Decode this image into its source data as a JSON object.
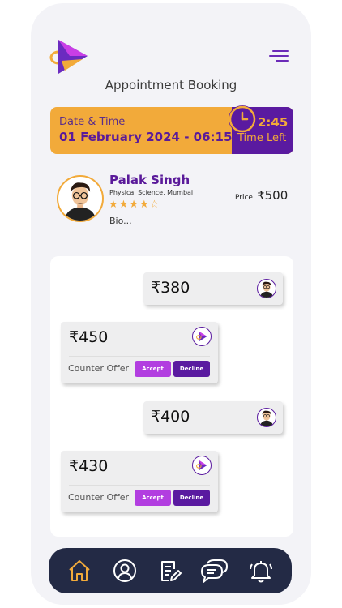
{
  "header": {
    "title": "Appointment Booking"
  },
  "datetime": {
    "label": "Date & Time",
    "value": "01 February 2024 - 06:15",
    "countdown": "2:45",
    "time_left_label": "Time Left"
  },
  "profile": {
    "name": "Palak Singh",
    "subtitle": "Physical Science, Mumbai",
    "rating": 4,
    "rating_max": 5,
    "stars_text": "★★★★☆",
    "bio": "Bio...",
    "price_label": "Price",
    "price_value": "₹500"
  },
  "offers": [
    {
      "side": "user",
      "amount": "₹380"
    },
    {
      "side": "tutor",
      "amount": "₹450",
      "counter_label": "Counter Offer",
      "accept_label": "Accept",
      "decline_label": "Decline"
    },
    {
      "side": "user",
      "amount": "₹400"
    },
    {
      "side": "tutor",
      "amount": "₹430",
      "counter_label": "Counter Offer",
      "accept_label": "Accept",
      "decline_label": "Decline"
    }
  ],
  "nav": {
    "items": [
      "home-icon",
      "profile-icon",
      "edit-note-icon",
      "chat-icon",
      "bell-icon"
    ],
    "active": "home-icon"
  },
  "colors": {
    "orange": "#f2aa3a",
    "purple": "#5a1aa0",
    "accept": "#b23ee0",
    "nav_bg": "#232a45"
  }
}
